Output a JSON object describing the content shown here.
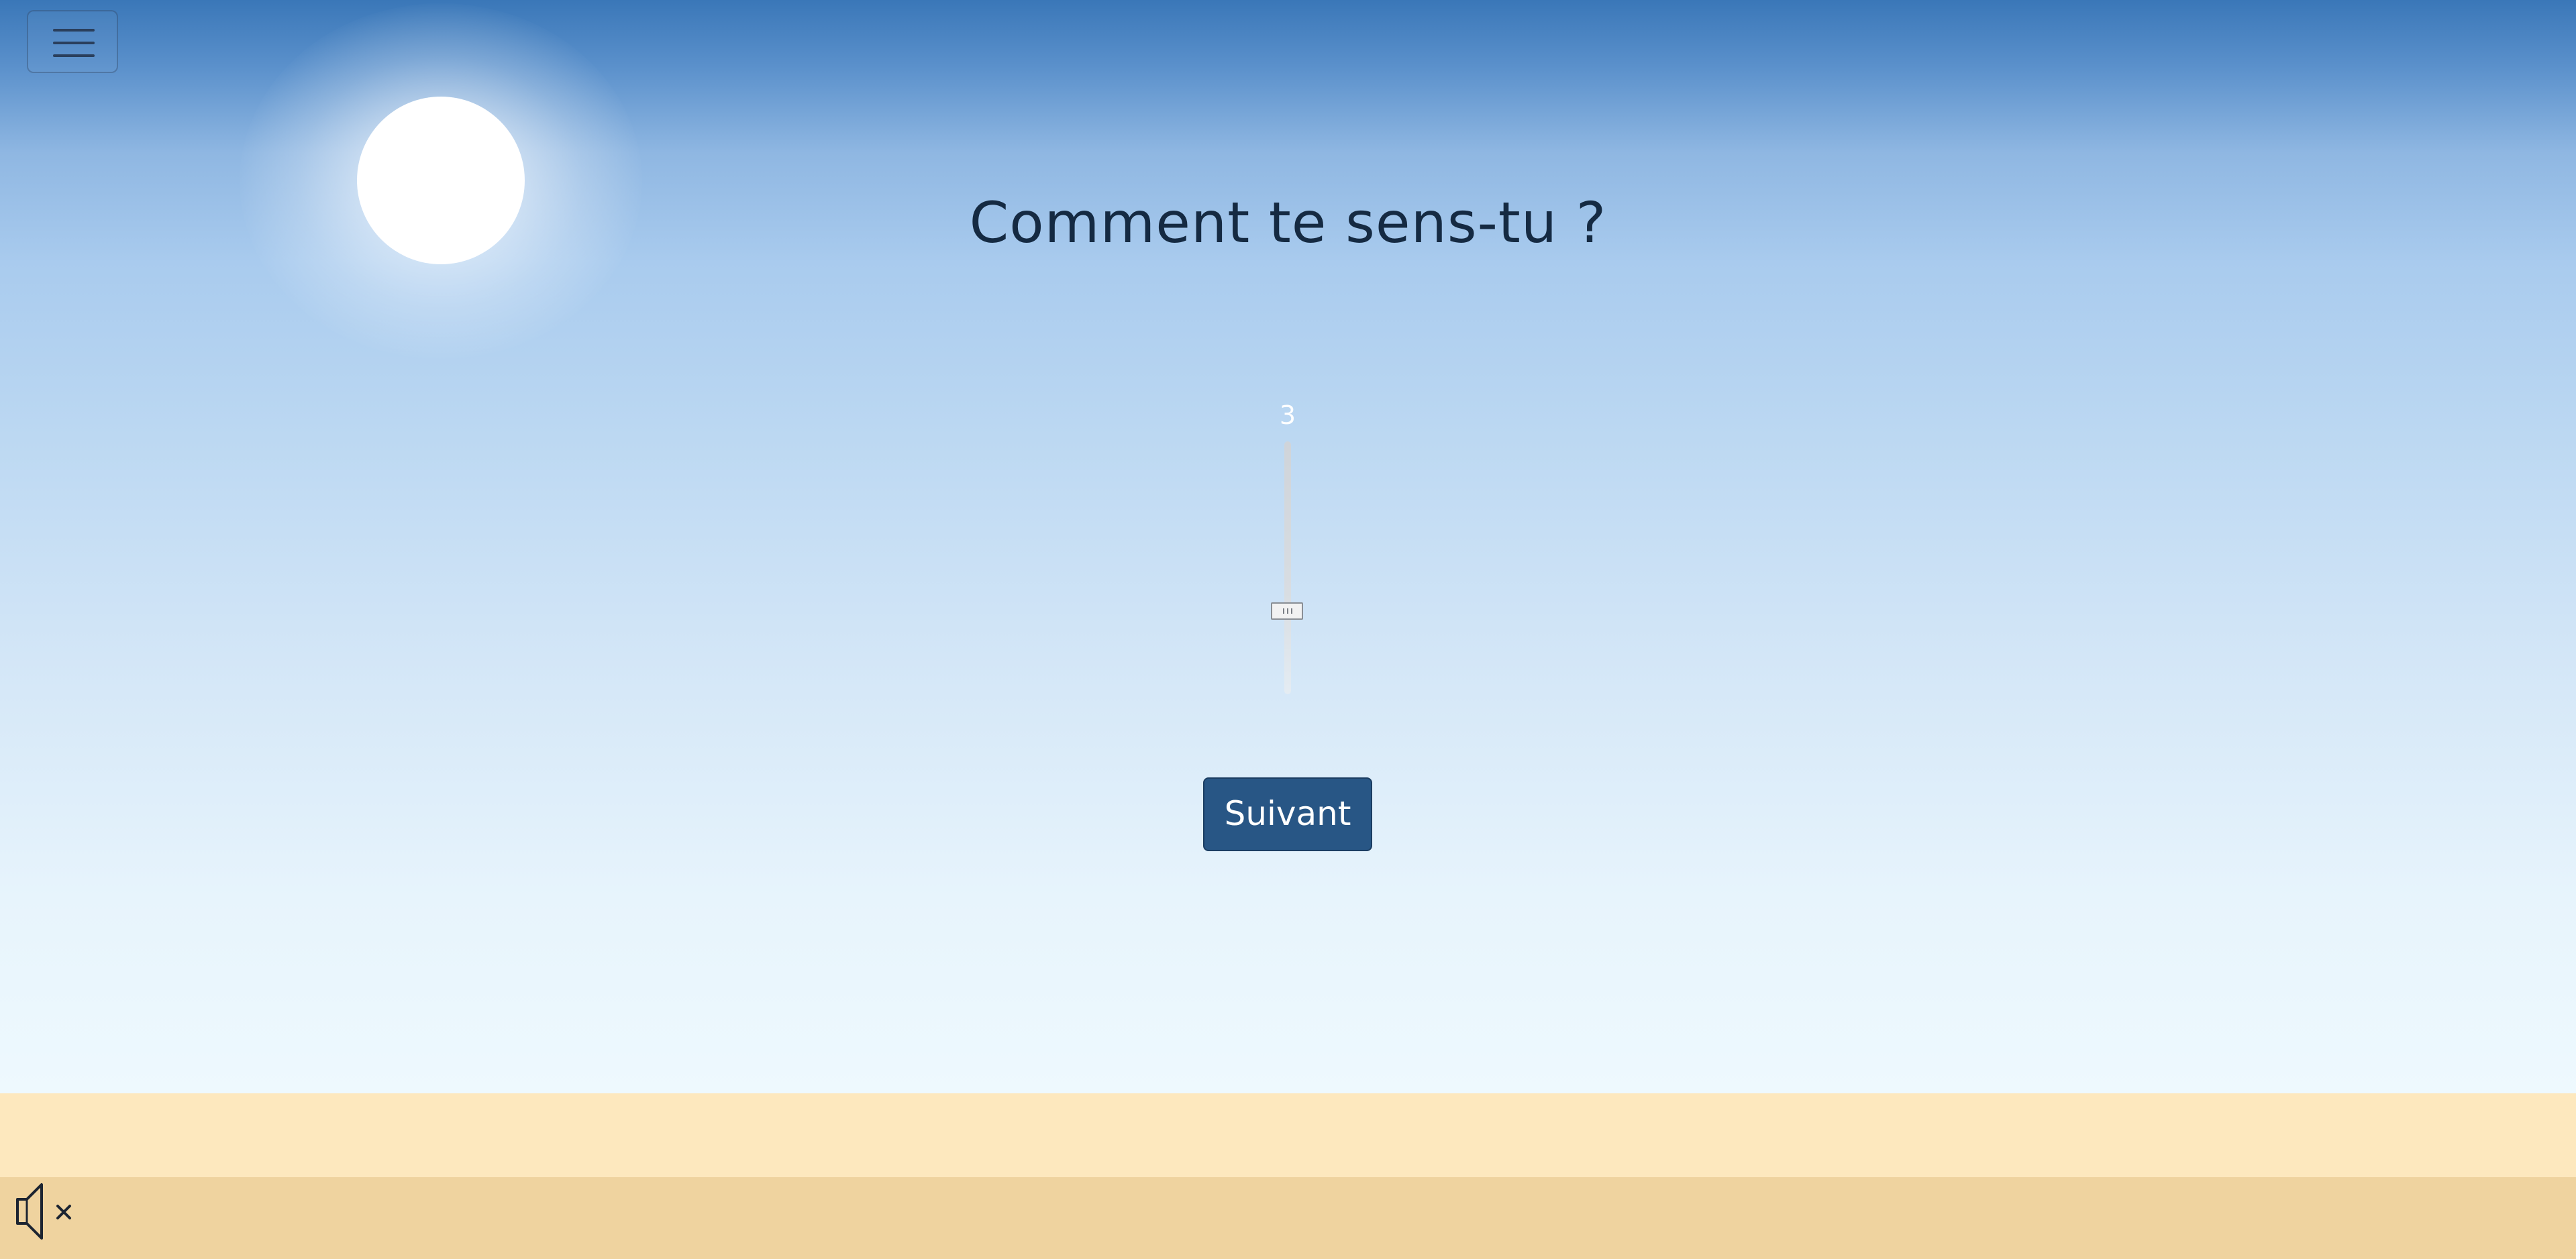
{
  "question": {
    "text": "Comment te sens-tu ?"
  },
  "mood_slider": {
    "value": "3",
    "level_fraction": 0.33
  },
  "next_button": {
    "label": "Suivant"
  },
  "icons": {
    "menu": "hamburger-menu-icon",
    "sound": "sound-muted-icon"
  },
  "colors": {
    "sky_top": "#3a77b8",
    "sky_bottom": "#eef9fe",
    "sand_light": "#fde8be",
    "sand_dark": "#efd39f",
    "button": "#285685",
    "question_text": "#152a42"
  }
}
